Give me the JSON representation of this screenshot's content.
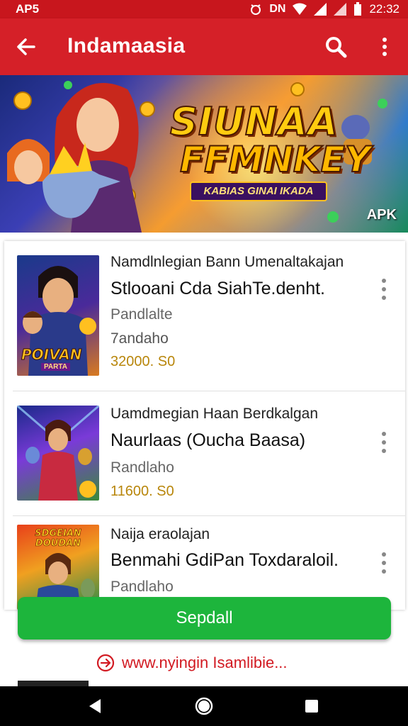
{
  "status_bar": {
    "left_label": "AP5",
    "time": "22:32",
    "icons": [
      "alarm-icon",
      "dnd-icon",
      "wifi-icon",
      "signal-icon",
      "signal-icon",
      "battery-icon"
    ]
  },
  "app_bar": {
    "title": "Indamaasia",
    "back_icon": "back-arrow-icon",
    "search_icon": "search-icon",
    "more_icon": "more-vert-icon"
  },
  "banner": {
    "line1": "SIUNAA",
    "line2": "FFMNKEY",
    "tag": "KABIAS GINAI IKADA",
    "badge": "APK"
  },
  "items": [
    {
      "subtitle": "Namdlnlegian Bann Umenaltakajan",
      "title": "Stlooani Cda SiahTe.denht.",
      "meta1": "Pandlalte",
      "meta2": "7andaho",
      "price": "32000. S0",
      "thumb_label": "POIVAN",
      "thumb_sub": "PARTA"
    },
    {
      "subtitle": "Uamdmegian Haan Berdkalgan",
      "title": "Naurlaas (Oucha Baasa)",
      "meta1": "Randlaho",
      "price": "11600. S0"
    },
    {
      "subtitle": "Naija eraolajan",
      "title": "Benmahi GdiPan Toxdaraloil.",
      "meta1": "Pandlaho",
      "thumb_label": "SDGEIAN DOUDAN"
    }
  ],
  "cta": {
    "label": "Sepdall"
  },
  "link": {
    "label": "www.nyingin Isamlibie..."
  },
  "colors": {
    "status_bar": "#c8161d",
    "app_bar": "#d52028",
    "cta": "#1db53c",
    "link": "#d21a22",
    "price": "#b8860b"
  },
  "nav_bar": {
    "icons": [
      "back-triangle-icon",
      "home-circle-icon",
      "recents-square-icon"
    ]
  }
}
